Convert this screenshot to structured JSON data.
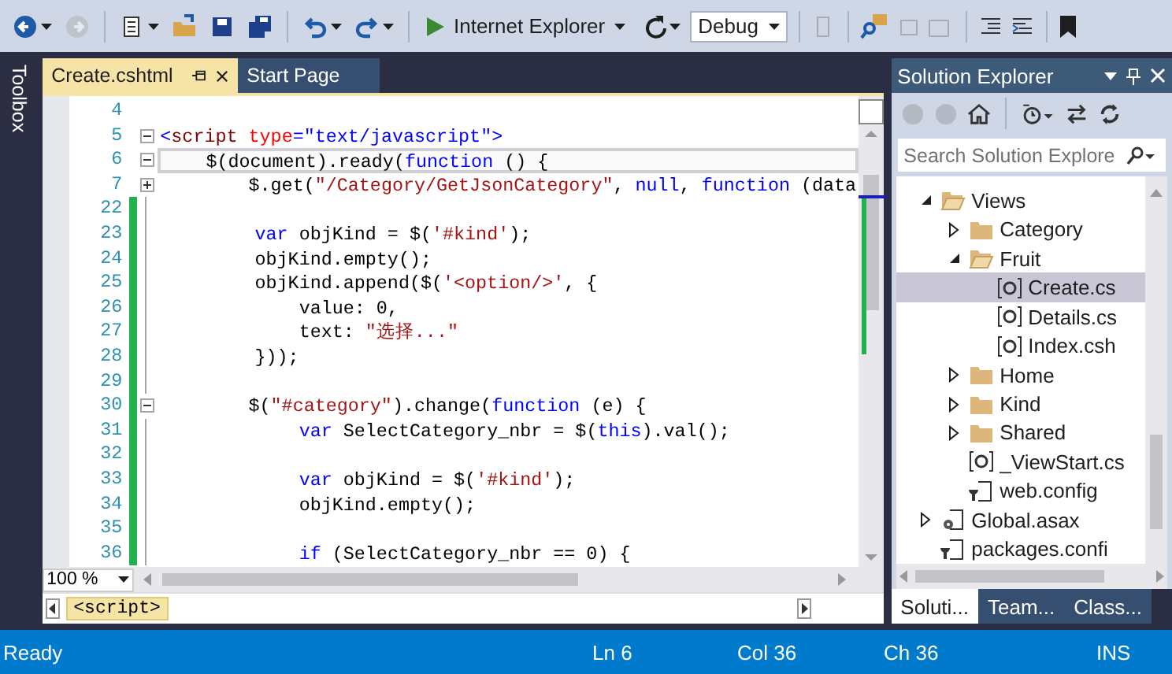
{
  "toolbar": {
    "items": [
      {
        "kind": "back",
        "disabled": false
      },
      {
        "kind": "forward",
        "disabled": true
      },
      {
        "kind": "new-project",
        "disabled": false
      },
      {
        "kind": "open",
        "disabled": false
      },
      {
        "kind": "save",
        "disabled": false
      },
      {
        "kind": "save-all",
        "disabled": false
      },
      {
        "kind": "undo",
        "disabled": false
      },
      {
        "kind": "redo",
        "disabled": false
      }
    ],
    "run_target": "Internet Explorer",
    "configuration": "Debug"
  },
  "sidebar": {
    "title": "Toolbox"
  },
  "tabs": [
    {
      "label": "Create.cshtml",
      "selected": true
    },
    {
      "label": "Start Page",
      "selected": false
    }
  ],
  "editor": {
    "lines": [
      {
        "number": "4",
        "changed": false,
        "current": false
      },
      {
        "number": "5",
        "collapsed": false,
        "changed": false,
        "current": false,
        "tokens": [
          {
            "kind": "delim",
            "text": "<"
          },
          {
            "kind": "tag",
            "text": "script"
          },
          {
            "kind": "attr",
            "text": " type"
          },
          {
            "kind": "delim",
            "text": "=\"text/javascript\">"
          }
        ]
      },
      {
        "number": "6",
        "collapsed": false,
        "changed": false,
        "current": true,
        "tokens": [
          {
            "kind": "plain",
            "text": "    $(document).ready("
          },
          {
            "kind": "keyword",
            "text": "function"
          },
          {
            "kind": "plain",
            "text": " () {"
          }
        ]
      },
      {
        "number": "7",
        "collapsed": true,
        "changed": false,
        "current": false,
        "tokens": [
          {
            "kind": "plain",
            "text": "        $.get("
          },
          {
            "kind": "string",
            "text": "\"/Category/GetJsonCategory\""
          },
          {
            "kind": "plain",
            "text": ", "
          },
          {
            "kind": "keyword",
            "text": "null"
          },
          {
            "kind": "plain",
            "text": ", "
          },
          {
            "kind": "keyword",
            "text": "function"
          },
          {
            "kind": "plain",
            "text": " (data"
          }
        ]
      },
      {
        "number": "22",
        "changed": true,
        "current": false
      },
      {
        "number": "23",
        "changed": true,
        "current": false,
        "tokens": [
          {
            "kind": "keyword",
            "text": "        var"
          },
          {
            "kind": "plain",
            "text": " objKind = $("
          },
          {
            "kind": "string",
            "text": "'#kind'"
          },
          {
            "kind": "plain",
            "text": ");"
          }
        ]
      },
      {
        "number": "24",
        "changed": true,
        "current": false,
        "tokens": [
          {
            "kind": "plain",
            "text": "        objKind.empty();"
          }
        ]
      },
      {
        "number": "25",
        "changed": true,
        "current": false,
        "tokens": [
          {
            "kind": "plain",
            "text": "        objKind.append($("
          },
          {
            "kind": "string",
            "text": "'<option/>'"
          },
          {
            "kind": "plain",
            "text": ", {"
          }
        ]
      },
      {
        "number": "26",
        "changed": true,
        "current": false,
        "tokens": [
          {
            "kind": "plain",
            "text": "            value: 0,"
          }
        ]
      },
      {
        "number": "27",
        "changed": true,
        "current": false,
        "tokens": [
          {
            "kind": "plain",
            "text": "            text: "
          },
          {
            "kind": "string",
            "text": "\"选择...\""
          }
        ]
      },
      {
        "number": "28",
        "changed": true,
        "current": false,
        "tokens": [
          {
            "kind": "plain",
            "text": "        }));"
          }
        ]
      },
      {
        "number": "29",
        "changed": true,
        "current": false
      },
      {
        "number": "30",
        "collapsed": false,
        "changed": true,
        "current": false,
        "tokens": [
          {
            "kind": "plain",
            "text": "        $("
          },
          {
            "kind": "string",
            "text": "\"#category\""
          },
          {
            "kind": "plain",
            "text": ").change("
          },
          {
            "kind": "keyword",
            "text": "function"
          },
          {
            "kind": "plain",
            "text": " (e) {"
          }
        ]
      },
      {
        "number": "31",
        "changed": true,
        "current": false,
        "tokens": [
          {
            "kind": "keyword",
            "text": "            var"
          },
          {
            "kind": "plain",
            "text": " SelectCategory_nbr = $("
          },
          {
            "kind": "keyword",
            "text": "this"
          },
          {
            "kind": "plain",
            "text": ").val();"
          }
        ]
      },
      {
        "number": "32",
        "changed": true,
        "current": false
      },
      {
        "number": "33",
        "changed": true,
        "current": false,
        "tokens": [
          {
            "kind": "keyword",
            "text": "            var"
          },
          {
            "kind": "plain",
            "text": " objKind = $("
          },
          {
            "kind": "string",
            "text": "'#kind'"
          },
          {
            "kind": "plain",
            "text": ");"
          }
        ]
      },
      {
        "number": "34",
        "changed": true,
        "current": false,
        "tokens": [
          {
            "kind": "plain",
            "text": "            objKind.empty();"
          }
        ]
      },
      {
        "number": "35",
        "changed": true,
        "current": false
      },
      {
        "number": "36",
        "changed": true,
        "current": false,
        "tokens": [
          {
            "kind": "keyword",
            "text": "            if"
          },
          {
            "kind": "plain",
            "text": " (SelectCategory_nbr == 0) {"
          }
        ]
      }
    ],
    "zoom": "100 %",
    "breadcrumb": "<script>"
  },
  "solution_explorer": {
    "title": "Solution Explorer",
    "search": {
      "placeholder": "Search Solution Explore"
    },
    "tree": [
      {
        "label": "Views",
        "kind": "folder",
        "expanded": true,
        "selected": false,
        "children": [
          {
            "label": "Category",
            "kind": "folder",
            "expanded": false,
            "selected": false
          },
          {
            "label": "Fruit",
            "kind": "folder",
            "expanded": true,
            "selected": false,
            "children": [
              {
                "label": "Create.cs",
                "kind": "razor",
                "selected": true
              },
              {
                "label": "Details.cs",
                "kind": "razor",
                "selected": false
              },
              {
                "label": "Index.csh",
                "kind": "razor",
                "selected": false
              }
            ]
          },
          {
            "label": "Home",
            "kind": "folder",
            "expanded": false,
            "selected": false
          },
          {
            "label": "Kind",
            "kind": "folder",
            "expanded": false,
            "selected": false
          },
          {
            "label": "Shared",
            "kind": "folder",
            "expanded": false,
            "selected": false
          },
          {
            "label": "_ViewStart.cs",
            "kind": "razor",
            "selected": false
          },
          {
            "label": "web.config",
            "kind": "config",
            "selected": false
          }
        ]
      },
      {
        "label": "Global.asax",
        "kind": "asax",
        "expanded": false,
        "selected": false
      },
      {
        "label": "packages.confi",
        "kind": "config",
        "selected": false
      }
    ],
    "tabs": [
      {
        "label": "Soluti...",
        "selected": true
      },
      {
        "label": "Team...",
        "selected": false
      },
      {
        "label": "Class...",
        "selected": false
      }
    ]
  },
  "status_bar": {
    "message": "Ready",
    "line": "Ln 6",
    "column": "Col 36",
    "char": "Ch 36",
    "mode": "INS"
  }
}
